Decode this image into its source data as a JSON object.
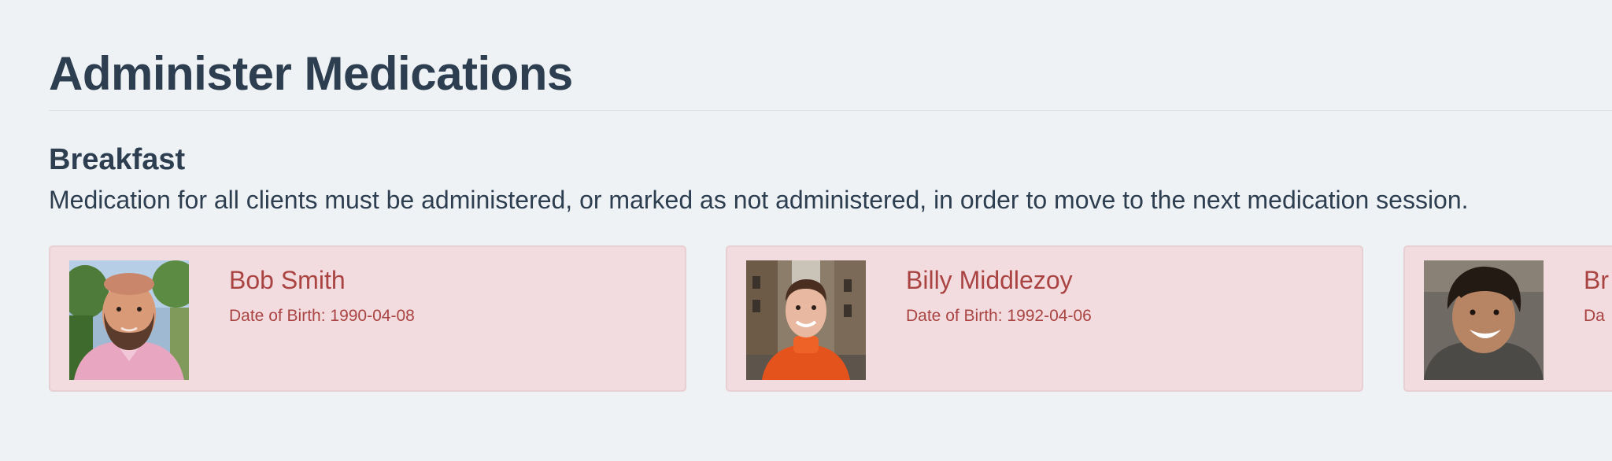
{
  "page": {
    "title": "Administer Medications"
  },
  "session": {
    "title": "Breakfast",
    "description": "Medication for all clients must be administered, or marked as not administered, in order to move to the next medication session."
  },
  "clients": [
    {
      "name": "Bob Smith",
      "dob_label": "Date of Birth:",
      "dob": "1990-04-08",
      "dob_text": "Date of Birth: 1990-04-08",
      "status": "not-administered"
    },
    {
      "name": "Billy Middlezoy",
      "dob_label": "Date of Birth:",
      "dob": "1992-04-06",
      "dob_text": "Date of Birth: 1992-04-06",
      "status": "not-administered"
    },
    {
      "name": "Br",
      "dob_label": "Da",
      "dob": "",
      "dob_text": "Da",
      "status": "not-administered"
    }
  ],
  "colors": {
    "page_background": "#eff2f5",
    "heading_text": "#2c3e50",
    "card_background": "#f3dcdf",
    "card_border": "#e8cfd3",
    "card_text": "#a94442"
  }
}
